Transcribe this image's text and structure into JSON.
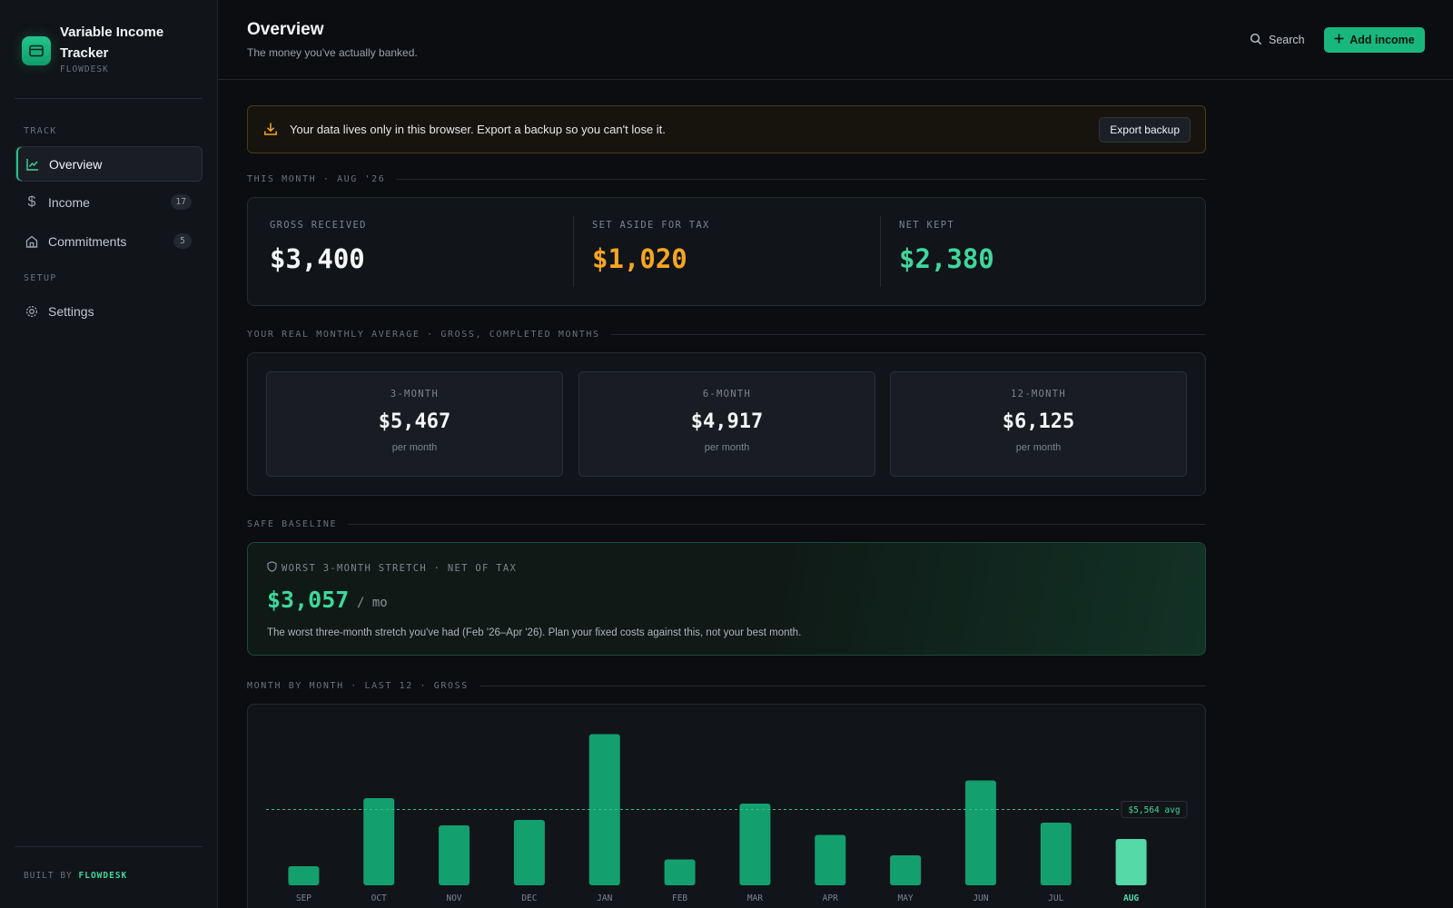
{
  "brand": {
    "title": "Variable Income Tracker",
    "subtitle": "FLOWDESK"
  },
  "sidebar": {
    "sections": {
      "track": "TRACK",
      "setup": "SETUP"
    },
    "items": [
      {
        "label": "Overview",
        "icon": "chart-line-icon",
        "active": true
      },
      {
        "label": "Income",
        "icon": "dollar-icon",
        "badge": "17"
      },
      {
        "label": "Commitments",
        "icon": "home-icon",
        "badge": "5"
      },
      {
        "label": "Settings",
        "icon": "gear-icon"
      }
    ],
    "footer": {
      "prefix": "BUILT BY",
      "name": "FLOWDESK"
    }
  },
  "header": {
    "title": "Overview",
    "subtitle": "The money you've actually banked.",
    "search_label": "Search",
    "add_label": "Add income"
  },
  "notice": {
    "text": "Your data lives only in this browser. Export a backup so you can't lose it.",
    "button": "Export backup"
  },
  "this_month": {
    "label": "THIS MONTH · AUG '26",
    "stats": [
      {
        "label": "GROSS RECEIVED",
        "value": "$3,400",
        "color": "#f5f6f7"
      },
      {
        "label": "SET ASIDE FOR TAX",
        "value": "$1,020",
        "color": "#f5a623"
      },
      {
        "label": "NET KEPT",
        "value": "$2,380",
        "color": "#3fd79c"
      }
    ]
  },
  "averages": {
    "label": "YOUR REAL MONTHLY AVERAGE · GROSS, COMPLETED MONTHS",
    "items": [
      {
        "label": "3-MONTH",
        "value": "$5,467",
        "unit": "per month"
      },
      {
        "label": "6-MONTH",
        "value": "$4,917",
        "unit": "per month"
      },
      {
        "label": "12-MONTH",
        "value": "$6,125",
        "unit": "per month"
      }
    ]
  },
  "baseline": {
    "section_label": "SAFE BASELINE",
    "label": "WORST 3-MONTH STRETCH · NET OF TAX",
    "value": "$3,057",
    "unit": "/ mo",
    "description": "The worst three-month stretch you've had (Feb '26–Apr '26). Plan your fixed costs against this, not your best month."
  },
  "chart_section_label": "MONTH BY MONTH · LAST 12 · GROSS",
  "chart_data": {
    "type": "bar",
    "categories": [
      "SEP",
      "OCT",
      "NOV",
      "DEC",
      "JAN",
      "FEB",
      "MAR",
      "APR",
      "MAY",
      "JUN",
      "JUL",
      "AUG"
    ],
    "values": [
      1400,
      6400,
      4400,
      4800,
      11100,
      1900,
      6000,
      3700,
      2200,
      7700,
      4600,
      3400
    ],
    "highlight": "AUG",
    "average": 5564,
    "average_label": "$5,564 avg",
    "ylim": [
      0,
      12000
    ],
    "colors": {
      "bar": "#13a06e",
      "highlight": "#55d9a6",
      "avg_line": "#2fbf8a"
    }
  }
}
